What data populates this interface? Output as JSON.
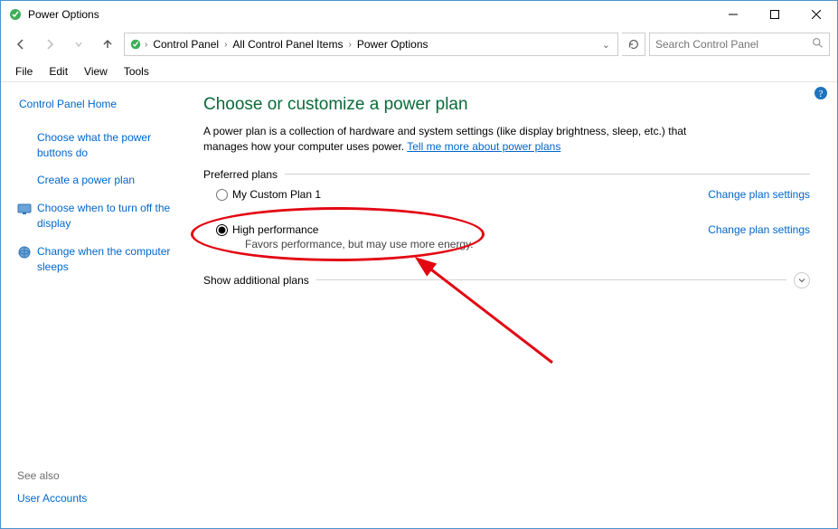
{
  "window": {
    "title": "Power Options"
  },
  "nav": {
    "breadcrumbs": [
      "Control Panel",
      "All Control Panel Items",
      "Power Options"
    ],
    "search_placeholder": "Search Control Panel"
  },
  "menu": {
    "items": [
      "File",
      "Edit",
      "View",
      "Tools"
    ]
  },
  "sidebar": {
    "home": "Control Panel Home",
    "links": [
      {
        "label": "Choose what the power buttons do",
        "icon": false
      },
      {
        "label": "Create a power plan",
        "icon": false
      },
      {
        "label": "Choose when to turn off the display",
        "icon": true,
        "icon_name": "monitor-icon"
      },
      {
        "label": "Change when the computer sleeps",
        "icon": true,
        "icon_name": "globe-icon"
      }
    ],
    "see_also_label": "See also",
    "see_also_links": [
      "User Accounts"
    ]
  },
  "main": {
    "heading": "Choose or customize a power plan",
    "description_prefix": "A power plan is a collection of hardware and system settings (like display brightness, sleep, etc.) that manages how your computer uses power. ",
    "description_link": "Tell me more about power plans",
    "preferred_label": "Preferred plans",
    "plans": [
      {
        "name": "My Custom Plan 1",
        "desc": "",
        "selected": false,
        "change_link": "Change plan settings"
      },
      {
        "name": "High performance",
        "desc": "Favors performance, but may use more energy.",
        "selected": true,
        "change_link": "Change plan settings"
      }
    ],
    "show_additional": "Show additional plans"
  }
}
